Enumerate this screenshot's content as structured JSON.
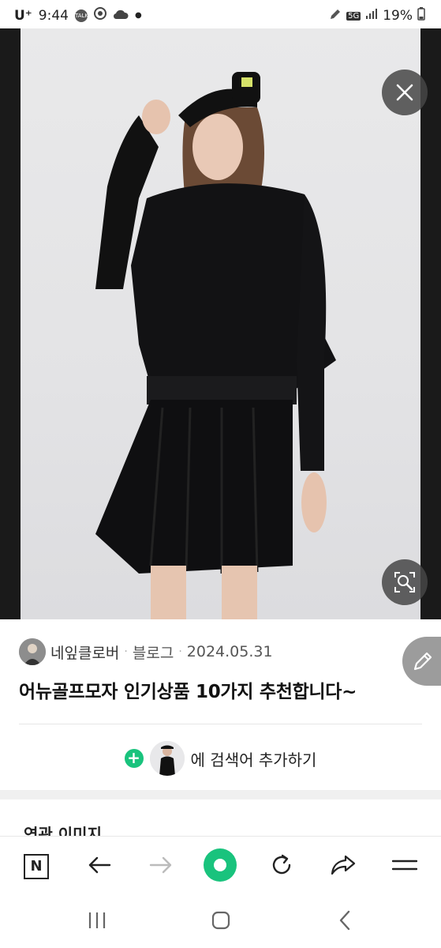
{
  "status_bar": {
    "carrier": "U⁺",
    "time": "9:44",
    "talk_icon": "TALK",
    "network": "5G",
    "battery": "19%"
  },
  "post": {
    "author": "네잎클로버",
    "source": "블로그",
    "date": "2024.05.31",
    "title": "어뉴골프모자 인기상품 10가지 추천합니다~"
  },
  "add_search": {
    "label": "에 검색어 추가하기"
  },
  "related": {
    "heading": "연관 이미지"
  },
  "browser_nav": {
    "home": "N",
    "back": "back",
    "forward": "forward",
    "green": "green-dot",
    "refresh": "refresh",
    "share": "share",
    "menu": "menu"
  },
  "icons": {
    "close": "close-icon",
    "lens": "image-search-icon",
    "edit": "pencil-icon"
  },
  "colors": {
    "accent_green": "#19c37d",
    "fab_gray": "#9c9c9c"
  }
}
